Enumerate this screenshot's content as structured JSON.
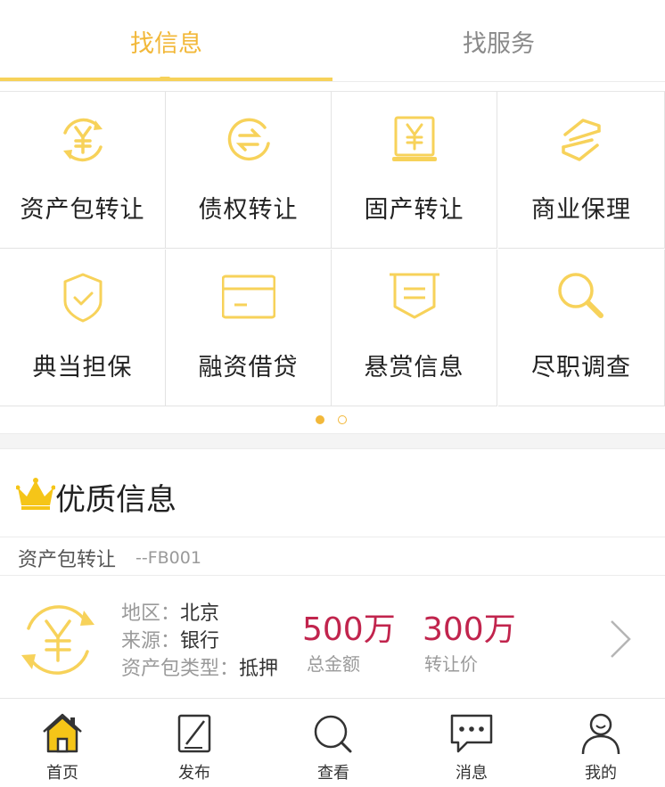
{
  "tabs": [
    {
      "label": "找信息",
      "active": true
    },
    {
      "label": "找服务",
      "active": false
    }
  ],
  "grid": {
    "items": [
      {
        "label": "资产包转让",
        "icon": "yuan-exchange-icon"
      },
      {
        "label": "债权转让",
        "icon": "transfer-arrows-icon"
      },
      {
        "label": "固产转让",
        "icon": "yuan-laptop-icon"
      },
      {
        "label": "商业保理",
        "icon": "zigzag-swap-icon"
      },
      {
        "label": "典当担保",
        "icon": "shield-check-icon"
      },
      {
        "label": "融资借贷",
        "icon": "card-icon"
      },
      {
        "label": "悬赏信息",
        "icon": "banner-icon"
      },
      {
        "label": "尽职调查",
        "icon": "magnifier-icon"
      }
    ]
  },
  "pager": {
    "pages": 2,
    "current": 1
  },
  "section": {
    "title": "优质信息",
    "icon": "crown-icon"
  },
  "category": {
    "name": "资产包转让",
    "code": "--FB001"
  },
  "listing": {
    "region_label": "地区：",
    "region_value": "北京",
    "source_label": "来源：",
    "source_value": "银行",
    "type_label": "资产包类型：",
    "type_value": "抵押",
    "total_amount": "500万",
    "total_label": "总金额",
    "transfer_price": "300万",
    "transfer_label": "转让价"
  },
  "nav": [
    {
      "label": "首页",
      "icon": "home-icon",
      "active": true
    },
    {
      "label": "发布",
      "icon": "edit-icon"
    },
    {
      "label": "查看",
      "icon": "search-icon"
    },
    {
      "label": "消息",
      "icon": "message-icon"
    },
    {
      "label": "我的",
      "icon": "user-icon"
    }
  ],
  "colors": {
    "accent": "#f2b83a",
    "price": "#c1244d",
    "icon_yellow": "#f7d25a"
  }
}
